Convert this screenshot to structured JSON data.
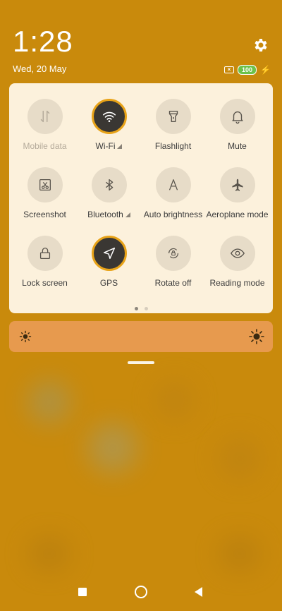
{
  "status": {
    "time": "1:28",
    "date": "Wed, 20 May",
    "battery": "100"
  },
  "tiles": [
    {
      "label": "Mobile data",
      "icon": "mobile-data-icon",
      "state": "disabled"
    },
    {
      "label": "Wi-Fi",
      "icon": "wifi-icon",
      "state": "on",
      "expand": true
    },
    {
      "label": "Flashlight",
      "icon": "flashlight-icon",
      "state": "off"
    },
    {
      "label": "Mute",
      "icon": "bell-icon",
      "state": "off"
    },
    {
      "label": "Screenshot",
      "icon": "screenshot-icon",
      "state": "off"
    },
    {
      "label": "Bluetooth",
      "icon": "bluetooth-icon",
      "state": "off",
      "expand": true
    },
    {
      "label": "Auto brightness",
      "icon": "auto-brightness-icon",
      "state": "off"
    },
    {
      "label": "Aeroplane mode",
      "icon": "airplane-icon",
      "state": "off"
    },
    {
      "label": "Lock screen",
      "icon": "lock-icon",
      "state": "off"
    },
    {
      "label": "GPS",
      "icon": "location-arrow-icon",
      "state": "on"
    },
    {
      "label": "Rotate off",
      "icon": "rotate-lock-icon",
      "state": "off"
    },
    {
      "label": "Reading mode",
      "icon": "eye-icon",
      "state": "off"
    }
  ],
  "pagination": {
    "pages": 2,
    "current": 1
  },
  "colors": {
    "background": "#C98A0C",
    "panel": "#FCF1DC",
    "tile_off": "#E7DCC8",
    "tile_on": "#3A3733",
    "tile_on_ring": "#E8A318",
    "brightness_bar": "#E79A4E",
    "battery": "#6CC24A"
  }
}
